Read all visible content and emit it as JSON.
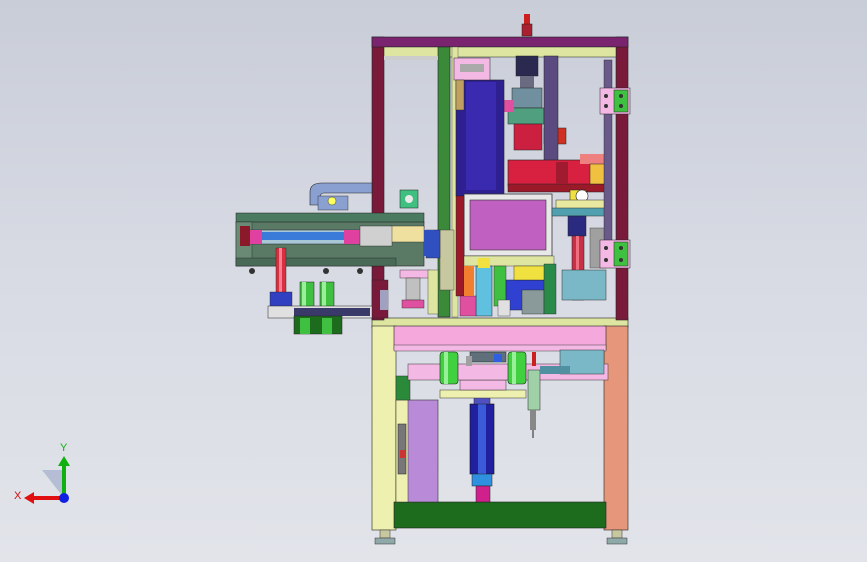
{
  "viewport": {
    "background_top": "#c9cdd8",
    "background_bottom": "#e2e4ea"
  },
  "triad": {
    "x_label": "X",
    "y_label": "Y",
    "x_color": "#e01010",
    "y_color": "#10b010",
    "z_color": "#1020e0"
  }
}
